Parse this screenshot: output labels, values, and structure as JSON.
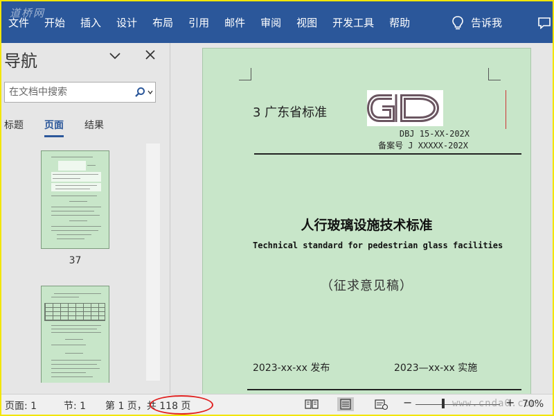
{
  "watermark": "道桥网",
  "ribbon": {
    "tabs": [
      "文件",
      "开始",
      "插入",
      "设计",
      "布局",
      "引用",
      "邮件",
      "审阅",
      "视图",
      "开发工具",
      "帮助"
    ],
    "tell_me": "告诉我"
  },
  "nav": {
    "title": "导航",
    "search_placeholder": "在文档中搜索",
    "subtabs": [
      "标题",
      "页面",
      "结果"
    ],
    "active_subtab": "页面",
    "thumbs": [
      {
        "page_number": "37"
      },
      {
        "page_number": ""
      }
    ]
  },
  "document": {
    "standard_label": "3 广东省标准",
    "logo_text": "GD",
    "code_line": "DBJ 15-XX-202X",
    "record_line": "备案号 J XXXXX-202X",
    "title": "人行玻璃设施技术标准",
    "subtitle_en": "Technical standard for pedestrian glass facilities",
    "draft_note": "（征求意见稿）",
    "publish": "2023-xx-xx 发布",
    "implement": "2023—xx-xx 实施",
    "page_color": "#c8e6c9"
  },
  "status": {
    "page": "页面: 1",
    "section": "节: 1",
    "page_of": "第 1 页，共 118 页",
    "zoom_minus": "−",
    "zoom_plus": "+",
    "zoom": "70%",
    "site_watermark": "www.cnda0.com"
  },
  "colors": {
    "ribbon": "#2b579a",
    "annotation_circle": "#e02020"
  }
}
